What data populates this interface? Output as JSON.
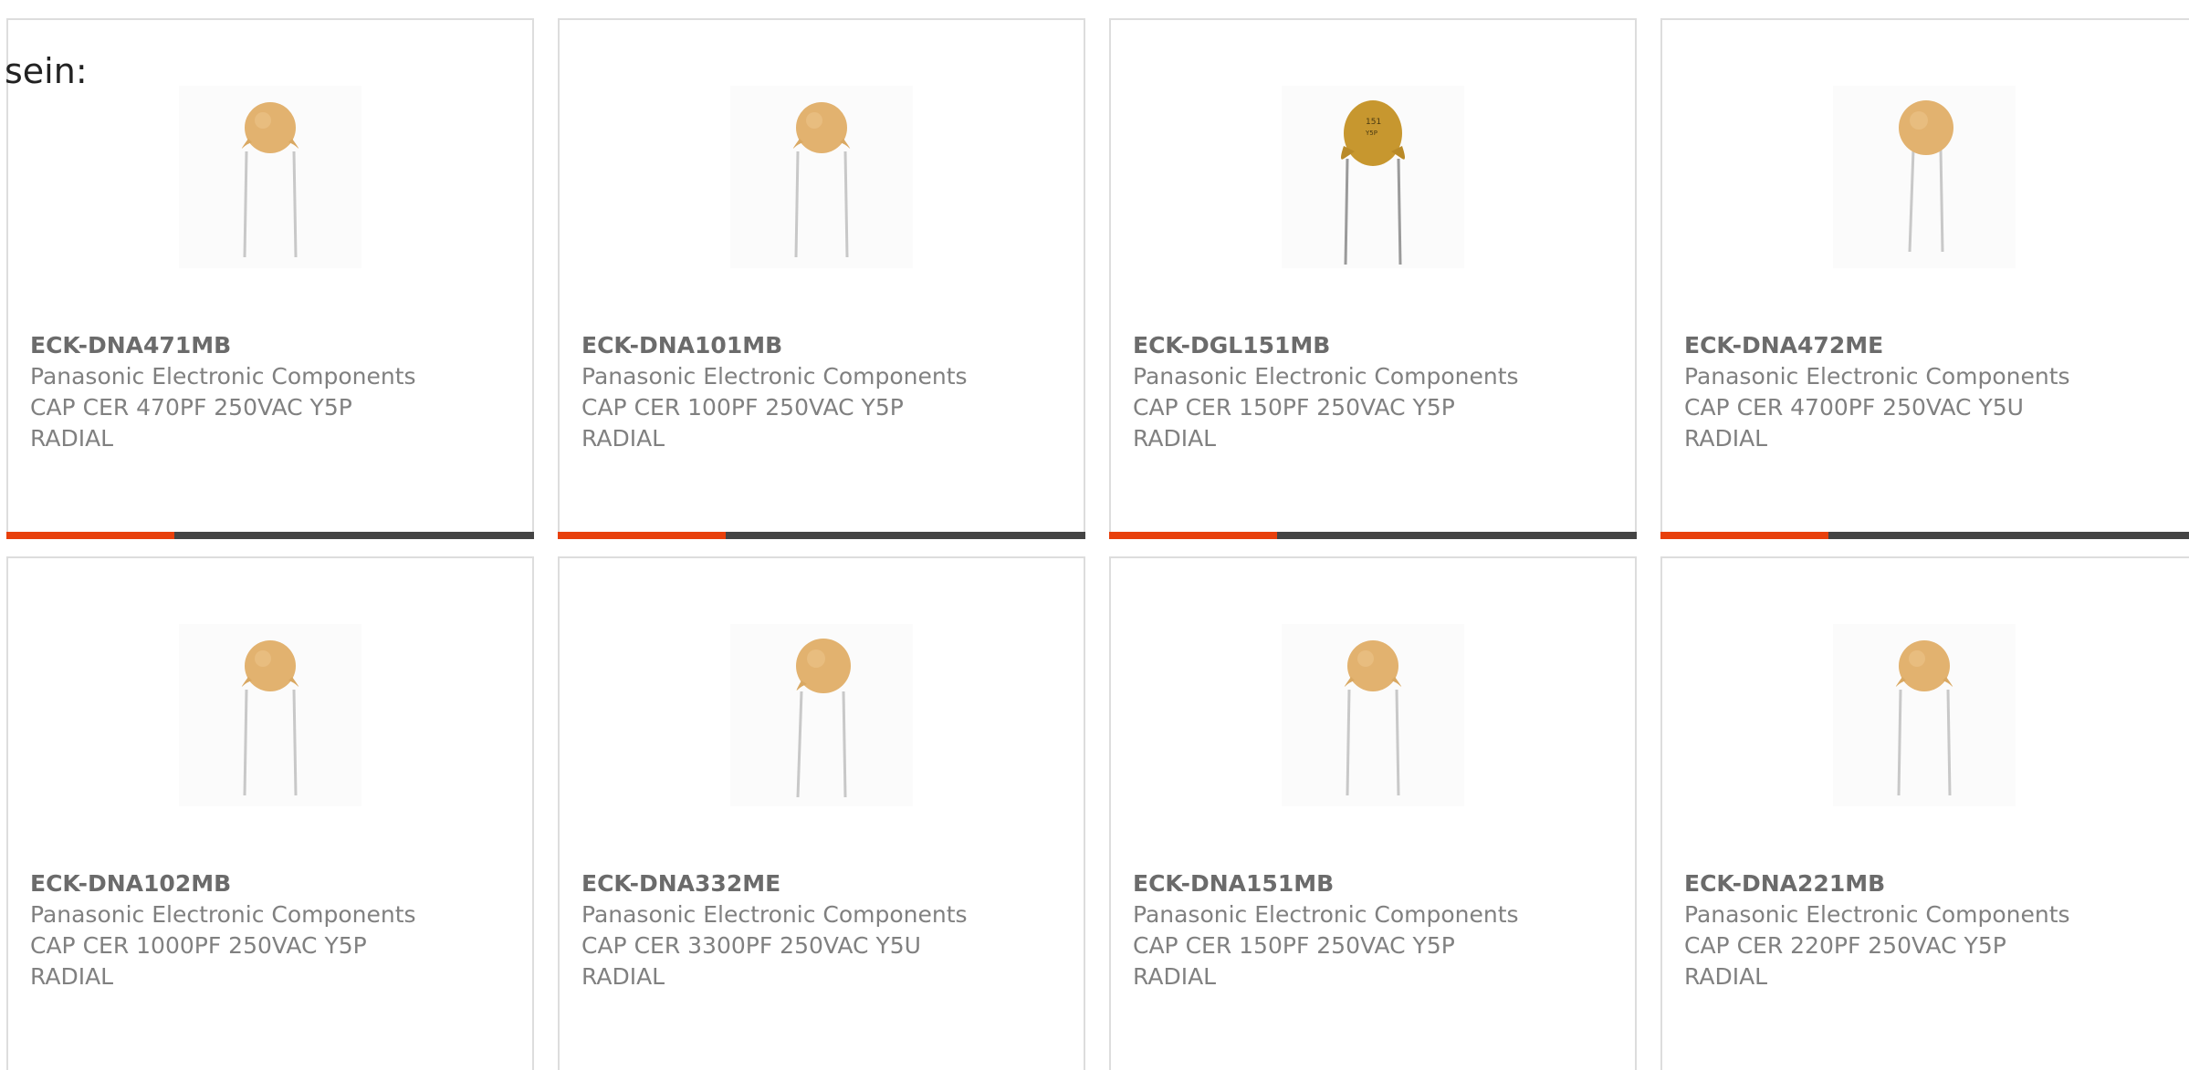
{
  "intro": "sein:",
  "accent_color": "#e8400c",
  "bar_color": "#444444",
  "products": [
    {
      "part_number": "ECK-DNA471MB",
      "manufacturer": "Panasonic Electronic Components",
      "description": "CAP CER 470PF 250VAC Y5P RADIAL",
      "image": "ceramic-disc-capacitor-tan"
    },
    {
      "part_number": "ECK-DNA101MB",
      "manufacturer": "Panasonic Electronic Components",
      "description": "CAP CER 100PF 250VAC Y5P RADIAL",
      "image": "ceramic-disc-capacitor-tan"
    },
    {
      "part_number": "ECK-DGL151MB",
      "manufacturer": "Panasonic Electronic Components",
      "description": "CAP CER 150PF 250VAC Y5P RADIAL",
      "image": "ceramic-disc-capacitor-brown"
    },
    {
      "part_number": "ECK-DNA472ME",
      "manufacturer": "Panasonic Electronic Components",
      "description": "CAP CER 4700PF 250VAC Y5U RADIAL",
      "image": "ceramic-disc-capacitor-tan"
    },
    {
      "part_number": "ECK-DNA102MB",
      "manufacturer": "Panasonic Electronic Components",
      "description": "CAP CER 1000PF 250VAC Y5P RADIAL",
      "image": "ceramic-disc-capacitor-tan"
    },
    {
      "part_number": "ECK-DNA332ME",
      "manufacturer": "Panasonic Electronic Components",
      "description": "CAP CER 3300PF 250VAC Y5U RADIAL",
      "image": "ceramic-disc-capacitor-tan"
    },
    {
      "part_number": "ECK-DNA151MB",
      "manufacturer": "Panasonic Electronic Components",
      "description": "CAP CER 150PF 250VAC Y5P RADIAL",
      "image": "ceramic-disc-capacitor-tan"
    },
    {
      "part_number": "ECK-DNA221MB",
      "manufacturer": "Panasonic Electronic Components",
      "description": "CAP CER 220PF 250VAC Y5P RADIAL",
      "image": "ceramic-disc-capacitor-tan"
    }
  ]
}
